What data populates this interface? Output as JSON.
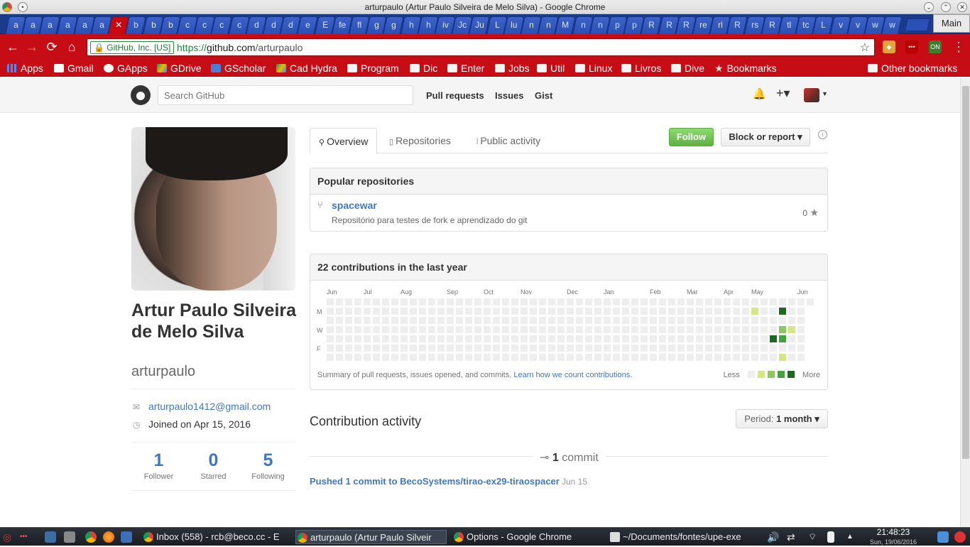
{
  "window": {
    "title": "arturpaulo (Artur Paulo Silveira de Melo Silva) - Google Chrome",
    "main_label": "Main"
  },
  "tabs": [
    "a",
    "a",
    "a",
    "a",
    "a",
    "a",
    "✕",
    "b",
    "b",
    "b",
    "c",
    "c",
    "c",
    "c",
    "d",
    "d",
    "d",
    "e",
    "E",
    "fe",
    "fl",
    "g",
    "g",
    "h",
    "h",
    "iv",
    "Jc",
    "Ju",
    "L",
    "lu",
    "n",
    "n",
    "M",
    "n",
    "n",
    "p",
    "p",
    "R",
    "R",
    "R",
    "re",
    "rl",
    "R",
    "rs",
    "R",
    "tl",
    "tc",
    "L",
    "v",
    "v",
    "w",
    "w"
  ],
  "toolbar": {
    "ev_badge": "GitHub, Inc. [US]",
    "url_scheme": "https://",
    "url_host": "github.com",
    "url_path": "/arturpaulo"
  },
  "bookmarks": [
    "Apps",
    "Gmail",
    "GApps",
    "GDrive",
    "GScholar",
    "Cad Hydra",
    "Program",
    "Dic",
    "Enter",
    "Jobs",
    "Util",
    "Linux",
    "Livros",
    "Dive",
    "Bookmarks",
    "Other bookmarks"
  ],
  "header": {
    "search_placeholder": "Search GitHub",
    "nav": [
      "Pull requests",
      "Issues",
      "Gist"
    ]
  },
  "profile": {
    "fullname": "Artur Paulo Silveira de Melo Silva",
    "username": "arturpaulo",
    "email": "arturpaulo1412@gmail.com",
    "joined": "Joined on Apr 15, 2016",
    "stats": [
      {
        "num": "1",
        "label": "Follower"
      },
      {
        "num": "0",
        "label": "Starred"
      },
      {
        "num": "5",
        "label": "Following"
      }
    ]
  },
  "profile_tabs": [
    "Overview",
    "Repositories",
    "Public activity"
  ],
  "actions": {
    "follow": "Follow",
    "block": "Block or report ▾"
  },
  "popular": {
    "title": "Popular repositories",
    "repo_name": "spacewar",
    "repo_desc": "Repositório para testes de fork e aprendizado do git",
    "stars": "0"
  },
  "contrib": {
    "title": "22 contributions in the last year",
    "months": [
      "Jun",
      "Jul",
      "Aug",
      "Sep",
      "Oct",
      "Nov",
      "Dec",
      "Jan",
      "Feb",
      "Mar",
      "Apr",
      "May",
      "Jun"
    ],
    "weekdays": [
      "M",
      "W",
      "F"
    ],
    "note": "Summary of pull requests, issues opened, and commits.",
    "note_link": "Learn how we count contributions.",
    "less": "Less",
    "more": "More",
    "colors": [
      "#eeeeee",
      "#d6e685",
      "#8cc665",
      "#44a340",
      "#1e6823"
    ],
    "active_days": [
      {
        "week": 46,
        "day": 1,
        "level": 1
      },
      {
        "week": 48,
        "day": 4,
        "level": 4
      },
      {
        "week": 49,
        "day": 1,
        "level": 4
      },
      {
        "week": 49,
        "day": 3,
        "level": 2
      },
      {
        "week": 49,
        "day": 4,
        "level": 3
      },
      {
        "week": 49,
        "day": 6,
        "level": 1
      },
      {
        "week": 50,
        "day": 3,
        "level": 1
      }
    ]
  },
  "activity": {
    "title": "Contribution activity",
    "period_label": "Period:",
    "period_value": "1 month ▾",
    "commit_num": "1",
    "commit_word": "commit",
    "commit_text": "Pushed 1 commit to BecoSystems/tirao-ex29-tiraospacer",
    "commit_date": "Jun 15"
  },
  "taskbar": {
    "items": [
      "Inbox (558) - rcb@beco.cc - E",
      "arturpaulo (Artur Paulo Silveir",
      "Options - Google Chrome",
      "~/Documents/fontes/upe-exe"
    ],
    "time": "21:48:23",
    "date": "Sun, 19/06/2016"
  }
}
